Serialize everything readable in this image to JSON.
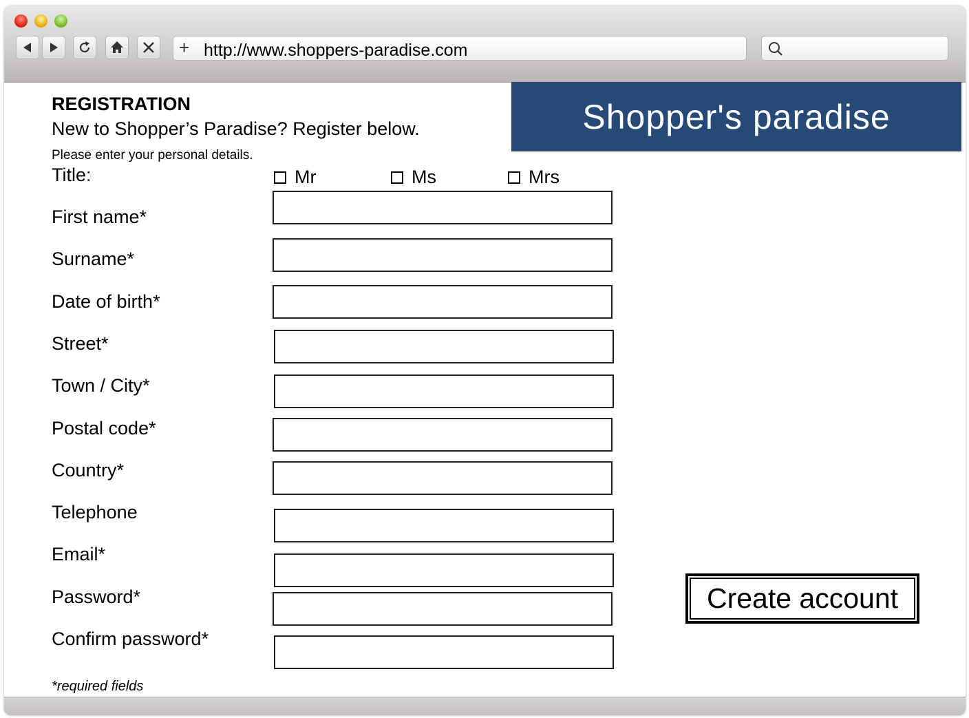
{
  "browser": {
    "url": "http://www.shoppers-paradise.com",
    "new_tab_symbol": "+",
    "icons": [
      "back-icon",
      "forward-icon",
      "reload-icon",
      "home-icon",
      "stop-icon",
      "search-icon"
    ]
  },
  "header": {
    "title": "REGISTRATION",
    "subtitle": "New to Shopper’s Paradise? Register below.",
    "hint": "Please enter your personal details."
  },
  "banner": {
    "text": "Shopper's paradise",
    "color": "#264a75"
  },
  "form": {
    "title_label": "Title:",
    "title_options": [
      "Mr",
      "Ms",
      "Mrs"
    ],
    "fields": [
      {
        "label": "First name*",
        "value": ""
      },
      {
        "label": "Surname*",
        "value": ""
      },
      {
        "label": "Date of birth*",
        "value": ""
      },
      {
        "label": "Street*",
        "value": ""
      },
      {
        "label": "Town / City*",
        "value": ""
      },
      {
        "label": "Postal code*",
        "value": ""
      },
      {
        "label": "Country*",
        "value": ""
      },
      {
        "label": "Telephone",
        "value": ""
      },
      {
        "label": "Email*",
        "value": ""
      },
      {
        "label": "Password*",
        "value": ""
      },
      {
        "label": "Confirm password*",
        "value": ""
      }
    ],
    "required_note": "*required fields",
    "submit_label": "Create account"
  }
}
